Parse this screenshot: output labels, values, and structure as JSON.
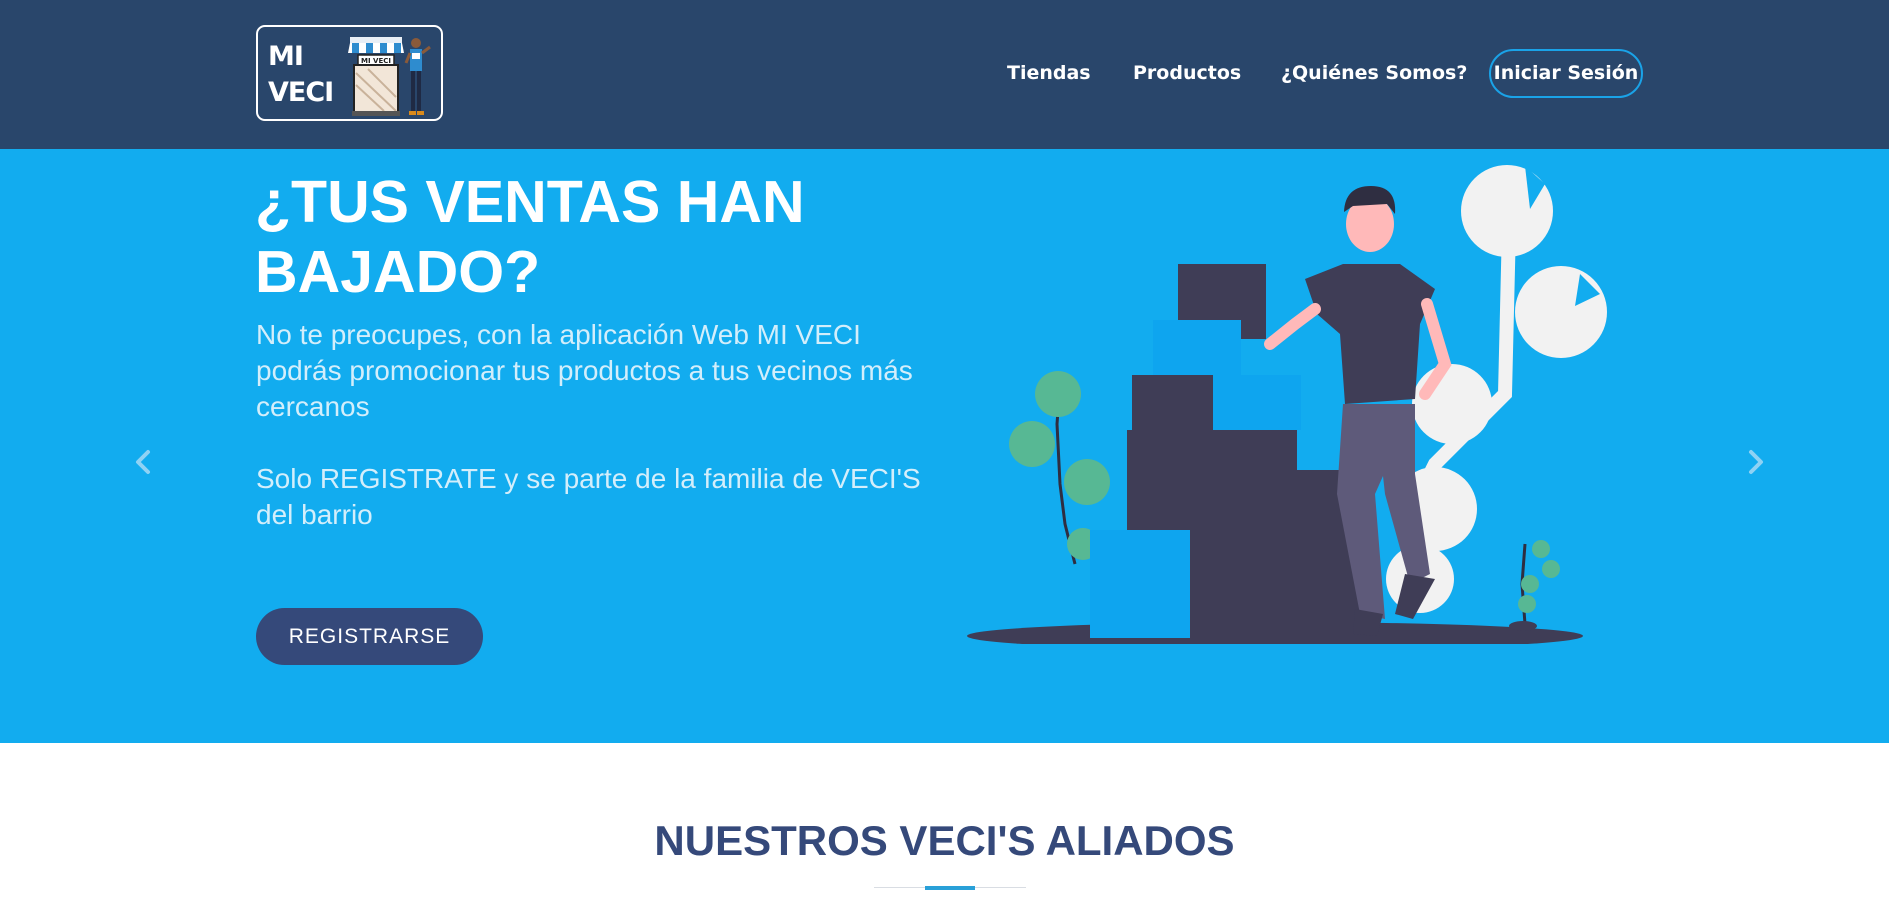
{
  "header": {
    "logo_text": "MI VECI",
    "logo_line1": "MI",
    "logo_line2": "VECI",
    "logo_sign": "MI VECI",
    "nav": [
      {
        "label": "Tiendas"
      },
      {
        "label": "Productos"
      },
      {
        "label": "¿Quiénes Somos?"
      }
    ],
    "login_label": "Iniciar Sesión"
  },
  "hero": {
    "title": "¿TUS VENTAS HAN BAJADO?",
    "text1": "No te preocupes, con la aplicación Web MI VECI podrás promocionar tus productos a tus vecinos más cercanos",
    "text2": "Solo REGISTRATE y se parte de la familia de VECI'S del barrio",
    "register_label": "REGISTRARSE",
    "prev_icon": "chevron-left-icon",
    "next_icon": "chevron-right-icon"
  },
  "section": {
    "title": "NUESTROS VECI'S ALIADOS"
  },
  "colors": {
    "header_bg": "#29466b",
    "hero_bg": "#12acef",
    "button_bg": "#35497a",
    "accent": "#29a0d8"
  }
}
